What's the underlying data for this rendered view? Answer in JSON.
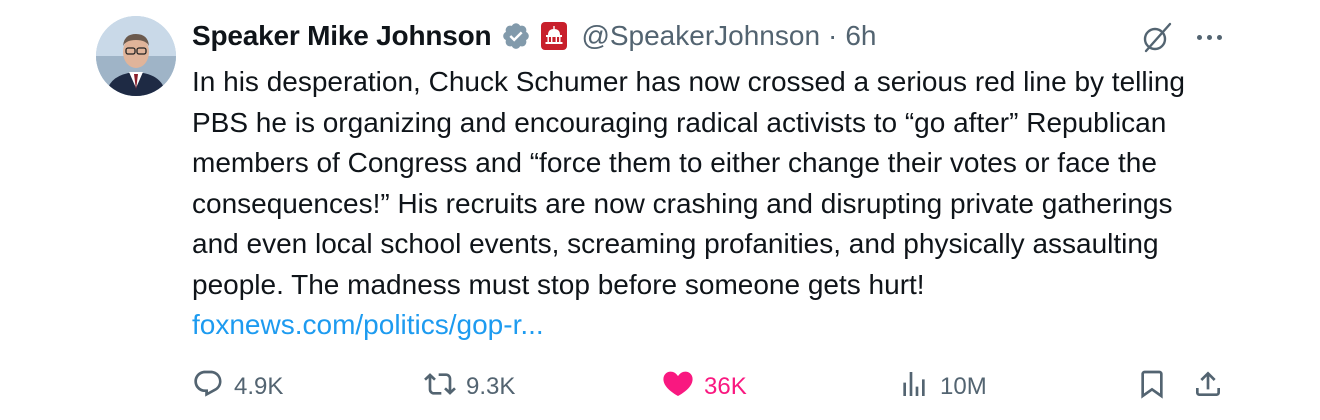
{
  "author": {
    "name": "Speaker Mike Johnson",
    "handle": "@SpeakerJohnson",
    "separator": "·",
    "time": "6h"
  },
  "tweet": {
    "text": "In his desperation, Chuck Schumer has now crossed a serious red line by telling PBS he is organizing and encouraging radical activists to “go after” Republican members of Congress and “force them to either change their votes or face the consequences!” His recruits are now crashing and disrupting private gatherings and even local school events, screaming profanities, and physically assaulting people. The madness must stop before someone gets hurt! ",
    "link": "foxnews.com/politics/gop-r..."
  },
  "actions": {
    "replies": "4.9K",
    "reposts": "9.3K",
    "likes": "36K",
    "views": "10M"
  },
  "icons": {
    "verified": "verified-badge-icon",
    "affiliation": "capitol-affiliation-icon",
    "grok": "grok-icon",
    "more": "more-icon",
    "reply": "reply-icon",
    "repost": "repost-icon",
    "like": "heart-icon",
    "views": "views-icon",
    "bookmark": "bookmark-icon",
    "share": "share-icon"
  },
  "colors": {
    "link": "#1d9bf0",
    "like": "#f91880",
    "secondary_text": "#536471",
    "verified": "#829aab",
    "affiliation": "#c81f2b"
  }
}
